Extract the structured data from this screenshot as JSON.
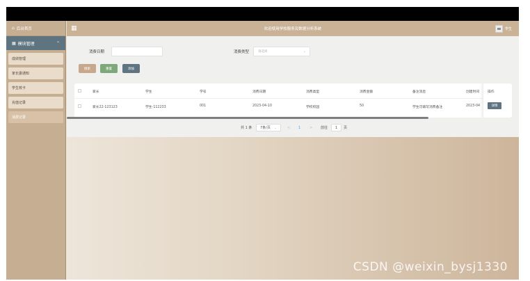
{
  "sidebar": {
    "home": "后台首页",
    "group": "模块管理",
    "items": [
      {
        "label": "成绩管理"
      },
      {
        "label": "家长委通知"
      },
      {
        "label": "学生校卡"
      },
      {
        "label": "充值记录"
      },
      {
        "label": "消费记录"
      }
    ]
  },
  "header": {
    "title": "欢迎使用学校服务及数据分析系统",
    "user": "学生"
  },
  "search": {
    "date_label": "消费日期",
    "date_value": "",
    "type_label": "消费类型",
    "type_placeholder": "请选择"
  },
  "buttons": {
    "query": "搜索",
    "reset": "重置",
    "add": "添加"
  },
  "table": {
    "columns": [
      "家长",
      "学生",
      "学号",
      "消费日期",
      "消费类型",
      "消费金额",
      "备注消息",
      "创建时间",
      "操作"
    ],
    "rows": [
      {
        "parent": "家长22-123123",
        "student": "学生-112233",
        "student_no": "001",
        "date": "2023-04-10",
        "type": "学校校园",
        "amount": "50",
        "note": "学生可填写消费备注",
        "created": "2023-04",
        "action": "详情"
      }
    ]
  },
  "pager": {
    "total": "共 1 条",
    "page_size": "7条/页",
    "prev": "<",
    "current": "1",
    "next": ">",
    "goto_label": "前往",
    "goto_value": "1",
    "page_suffix": "页"
  },
  "watermark": "CSDN @weixin_bysj1330",
  "colors": {
    "header": "#c9b295",
    "sidebar": "#c6ae93",
    "group": "#5e7480",
    "btn_query": "#c8a88c",
    "btn_reset": "#7fa87a",
    "btn_add": "#5e7480"
  }
}
